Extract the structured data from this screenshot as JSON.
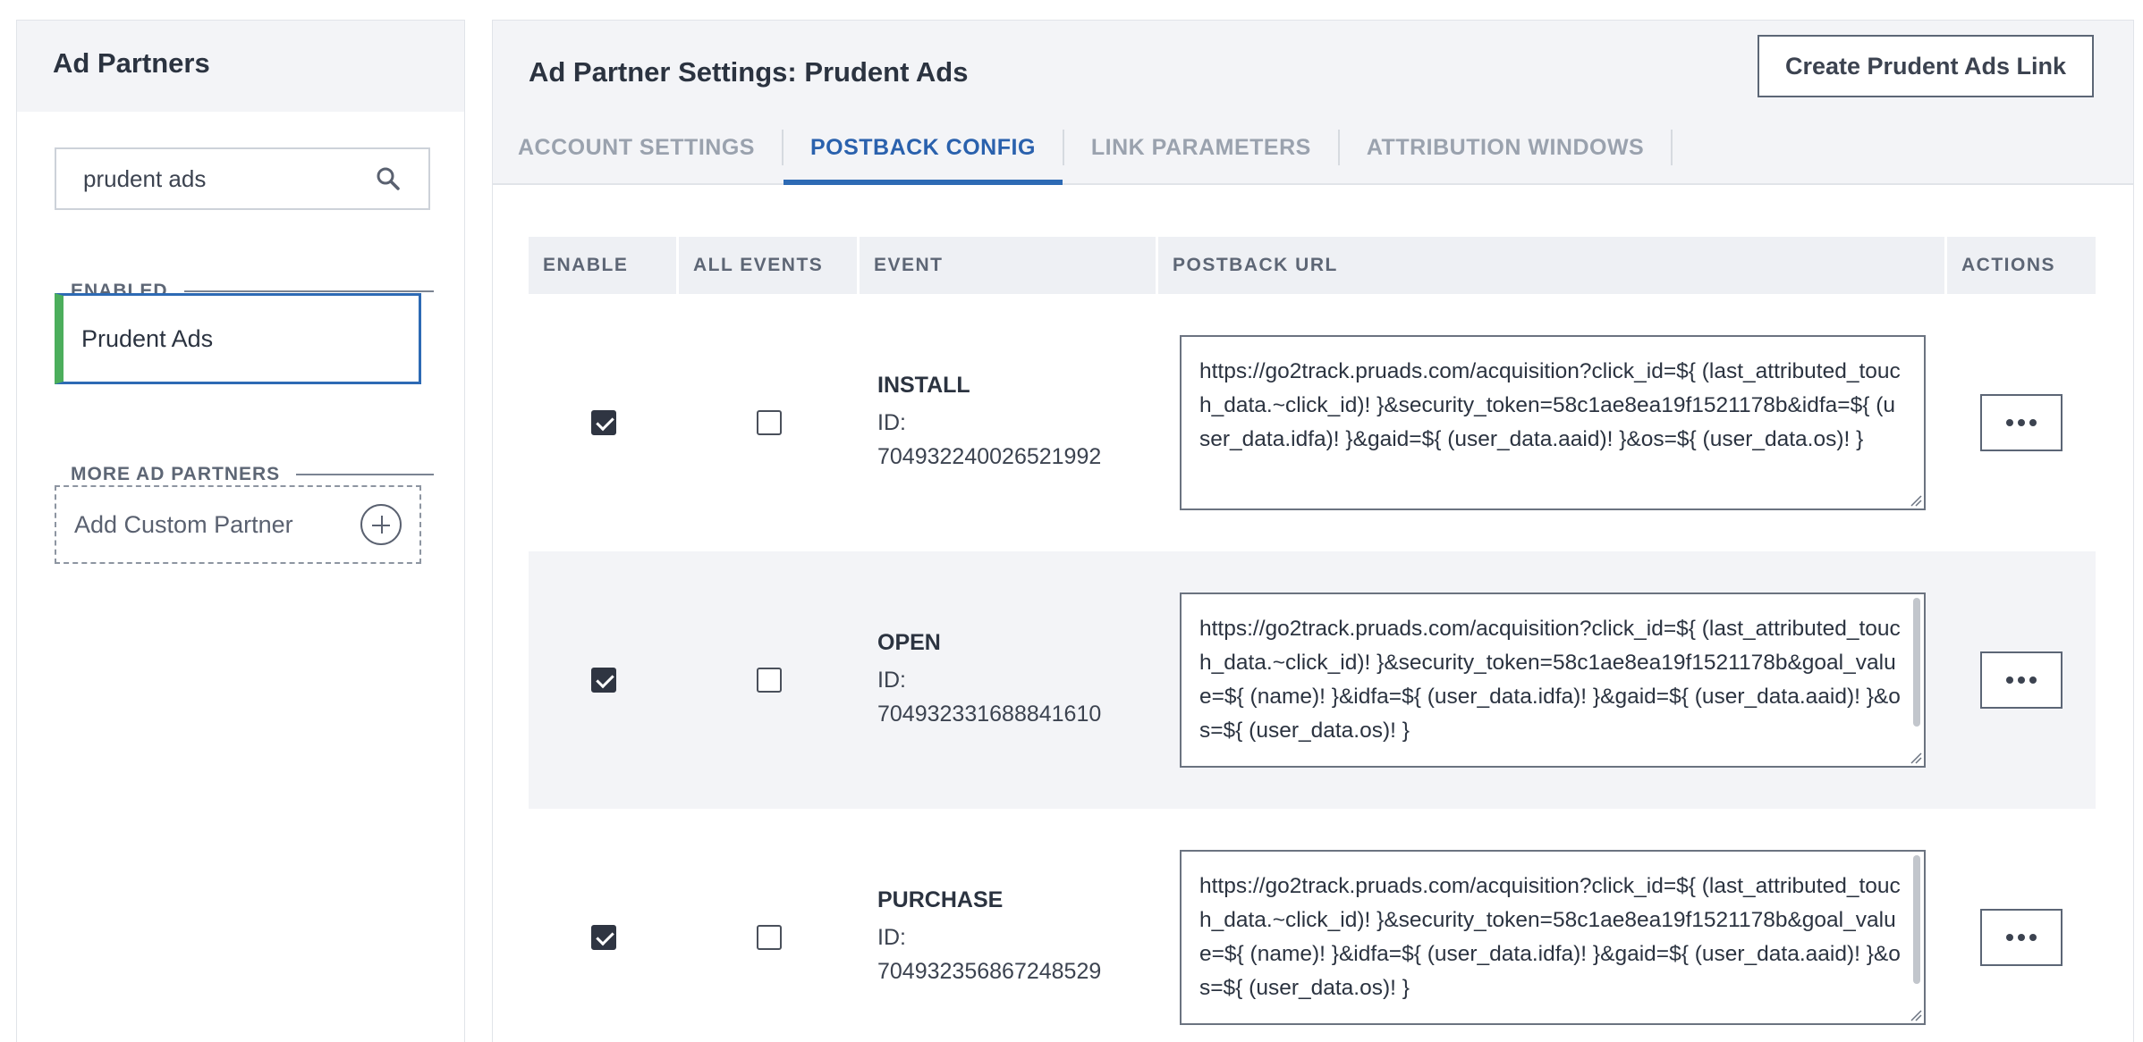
{
  "sidebar": {
    "title": "Ad Partners",
    "search": {
      "value": "prudent ads",
      "icon": "search-icon"
    },
    "enabled_label": "ENABLED",
    "enabled_items": [
      {
        "label": "Prudent Ads",
        "active_color": "#4cae5c"
      }
    ],
    "more_label": "MORE AD PARTNERS",
    "add_custom_label": "Add Custom Partner"
  },
  "main": {
    "title": "Ad Partner Settings: Prudent Ads",
    "create_button": "Create Prudent Ads Link",
    "tabs": [
      {
        "label": "ACCOUNT SETTINGS",
        "active": false
      },
      {
        "label": "POSTBACK CONFIG",
        "active": true
      },
      {
        "label": "LINK PARAMETERS",
        "active": false
      },
      {
        "label": "ATTRIBUTION WINDOWS",
        "active": false
      }
    ],
    "table": {
      "headers": {
        "enable": "ENABLE",
        "all_events": "ALL EVENTS",
        "event": "EVENT",
        "url": "POSTBACK URL",
        "actions": "ACTIONS"
      },
      "rows": [
        {
          "enabled": true,
          "all_events": false,
          "event": "INSTALL",
          "id_label": "ID:",
          "id": "704932240026521992",
          "url": "https://go2track.pruads.com/acquisition?click_id=${ (last_attributed_touch_data.~click_id)! }&security_token=58c1ae8ea19f1521178b&idfa=${ (user_data.idfa)! }&gaid=${ (user_data.aaid)! }&os=${ (user_data.os)! }"
        },
        {
          "enabled": true,
          "all_events": false,
          "event": "OPEN",
          "id_label": "ID:",
          "id": "704932331688841610",
          "url": "https://go2track.pruads.com/acquisition?click_id=${ (last_attributed_touch_data.~click_id)! }&security_token=58c1ae8ea19f1521178b&goal_value=${ (name)! }&idfa=${ (user_data.idfa)! }&gaid=${ (user_data.aaid)! }&os=${ (user_data.os)! }"
        },
        {
          "enabled": true,
          "all_events": false,
          "event": "PURCHASE",
          "id_label": "ID:",
          "id": "704932356867248529",
          "url": "https://go2track.pruads.com/acquisition?click_id=${ (last_attributed_touch_data.~click_id)! }&security_token=58c1ae8ea19f1521178b&goal_value=${ (name)! }&idfa=${ (user_data.idfa)! }&gaid=${ (user_data.aaid)! }&os=${ (user_data.os)! }"
        }
      ]
    }
  },
  "colors": {
    "accent": "#2d6ab4",
    "enabled_bar": "#4cae5c"
  }
}
